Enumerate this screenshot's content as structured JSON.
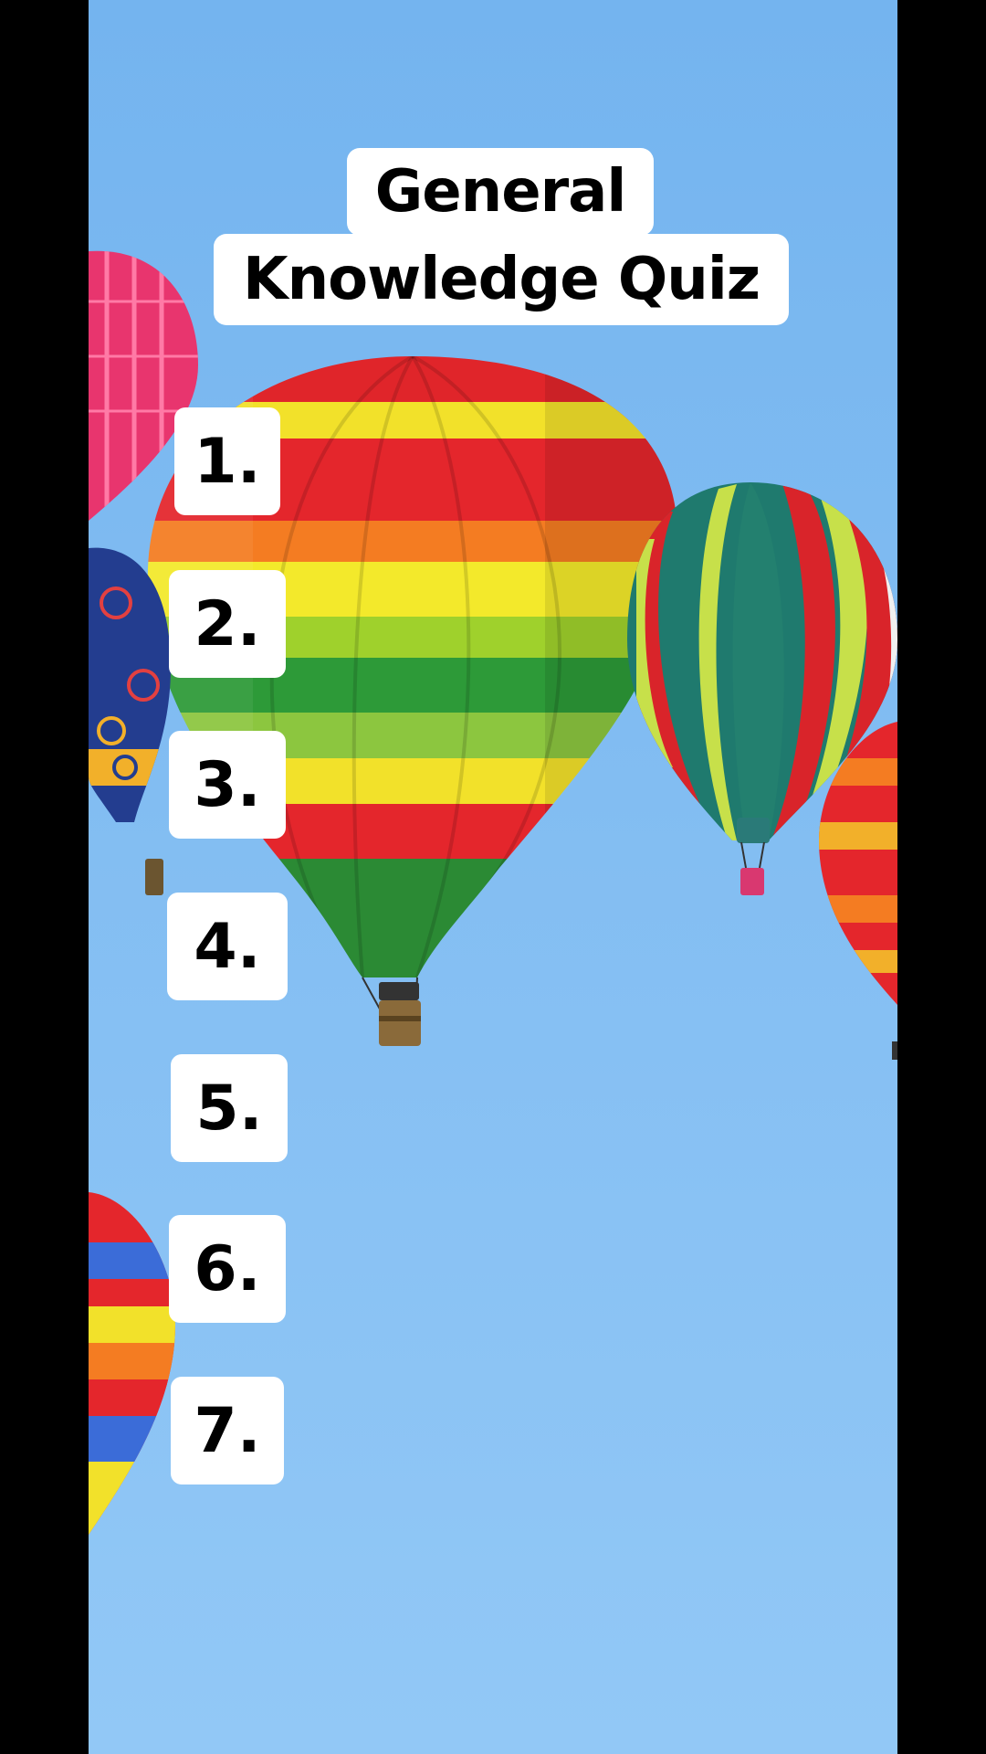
{
  "quiz": {
    "title_line1": "General",
    "title_line2": "Knowledge Quiz",
    "items": [
      {
        "label": "1."
      },
      {
        "label": "2."
      },
      {
        "label": "3."
      },
      {
        "label": "4."
      },
      {
        "label": "5."
      },
      {
        "label": "6."
      },
      {
        "label": "7."
      }
    ]
  },
  "background": {
    "sky_color": "#82bdf2",
    "letterbox_color": "#000000",
    "image_subject": "hot-air-balloons"
  }
}
